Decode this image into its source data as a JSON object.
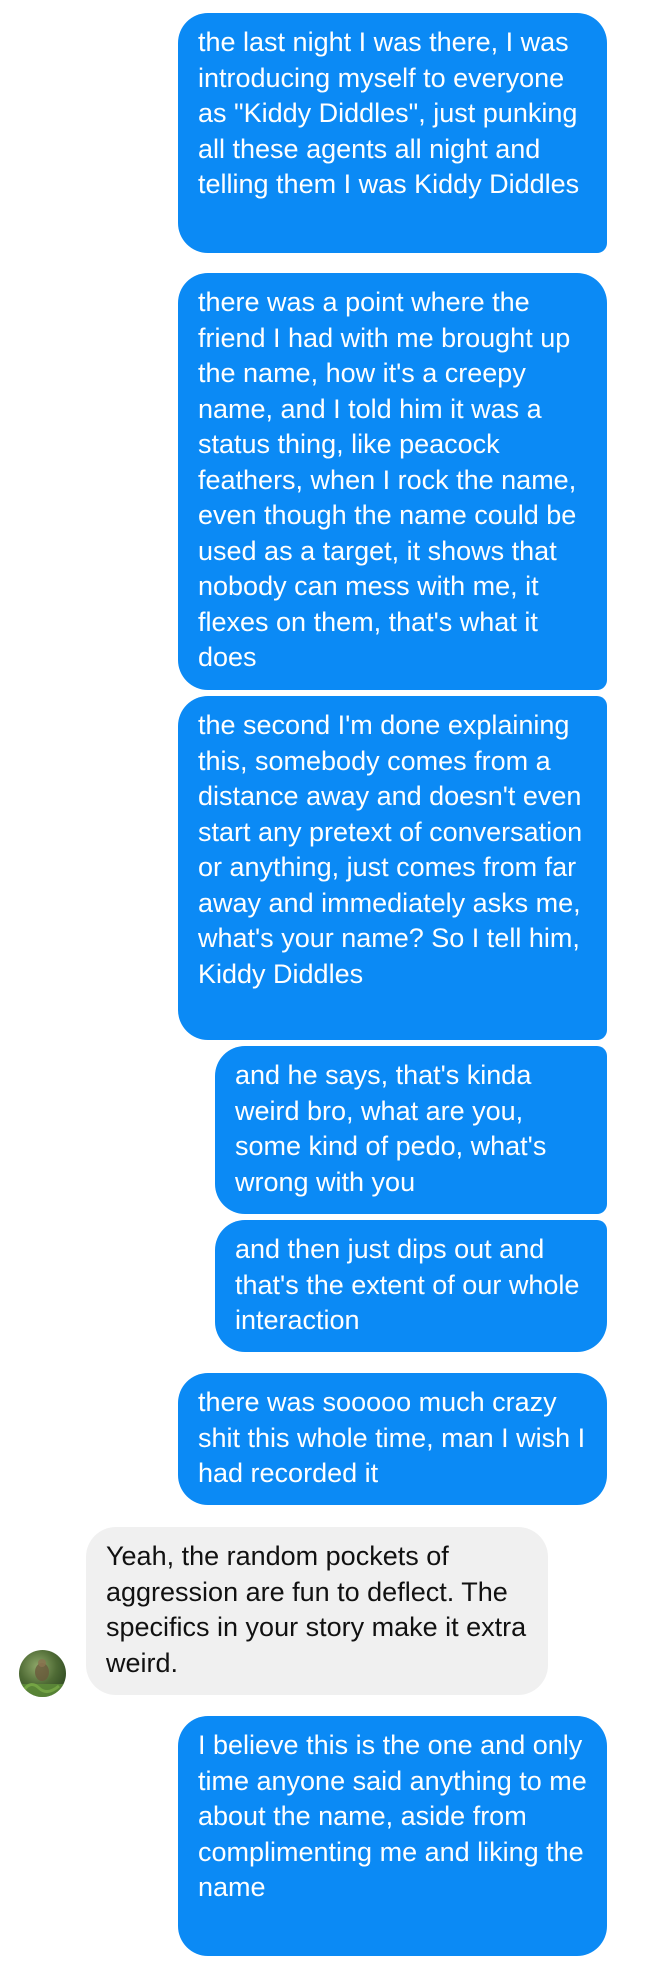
{
  "colors": {
    "sent_bubble": "#0b8af5",
    "sent_text": "#ffffff",
    "received_bubble": "#f0f0f0",
    "received_text": "#111111"
  },
  "messages": [
    {
      "direction": "sent",
      "text": "the last night I was there, I was introducing myself to everyone as \"Kiddy Diddles\", just punking all these agents all night and telling them I was Kiddy Diddles"
    },
    {
      "direction": "sent",
      "text": "there was a point where the friend I had with me brought up the name, how it's a creepy name, and I told him it was a status thing, like peacock feathers, when I rock the name, even though the name could be used as a target, it shows that nobody can mess with me, it flexes on them, that's what it does"
    },
    {
      "direction": "sent",
      "text": "the second I'm done explaining this, somebody comes from a distance away and doesn't even start any pretext of conversation or anything, just comes from far away and immediately asks me, what's your name? So I tell him, Kiddy Diddles"
    },
    {
      "direction": "sent",
      "text": "and he says, that's kinda weird bro, what are you, some kind of pedo, what's wrong with you"
    },
    {
      "direction": "sent",
      "text": "and then just dips out and that's the extent of our whole interaction"
    },
    {
      "direction": "sent",
      "text": "there was sooooo much crazy shit this whole time, man I wish I had recorded it"
    },
    {
      "direction": "received",
      "text": "Yeah, the random pockets of aggression are fun to deflect. The specifics in your story make it extra weird.",
      "avatar_icon": "contact-avatar"
    },
    {
      "direction": "sent",
      "text": "I believe this is the one and only time anyone said anything to me about the name, aside from complimenting me and liking the name"
    }
  ]
}
